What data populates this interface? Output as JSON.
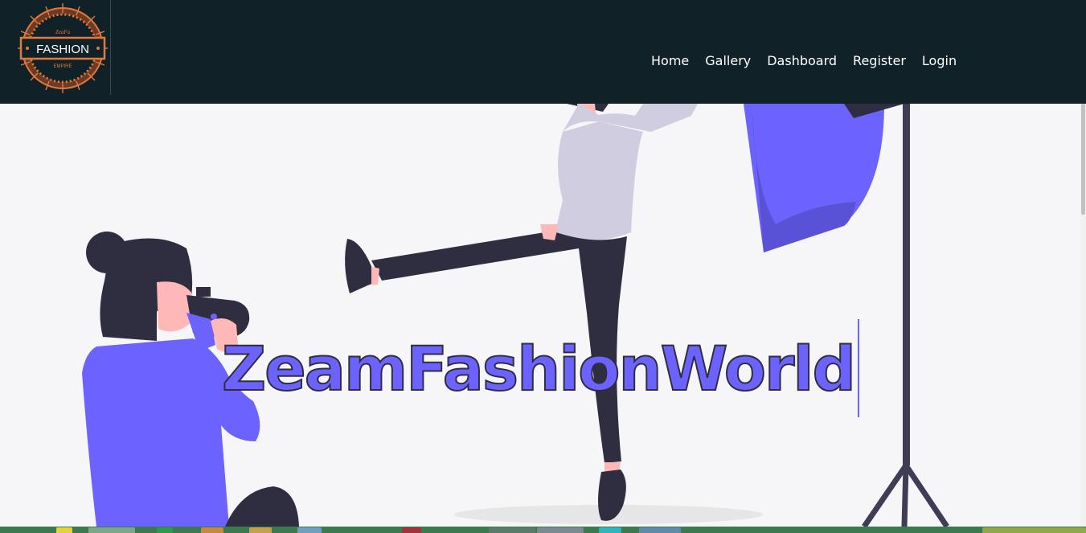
{
  "logo": {
    "main_text": "FASHION",
    "top_text": "ZeaFa",
    "bottom_text": "EMPIRE",
    "accent_color": "#e07a3f"
  },
  "nav": {
    "items": [
      {
        "label": "Home"
      },
      {
        "label": "Gallery"
      },
      {
        "label": "Dashboard"
      },
      {
        "label": "Register"
      },
      {
        "label": "Login"
      }
    ]
  },
  "hero": {
    "title": "ZeamFashionWorld",
    "accent_color": "#6c63ff",
    "dark_color": "#2f2e41"
  },
  "taskbar": {
    "icons": [
      "start-icon",
      "chrome-icon",
      "explorer-icon",
      "app-icon"
    ]
  }
}
